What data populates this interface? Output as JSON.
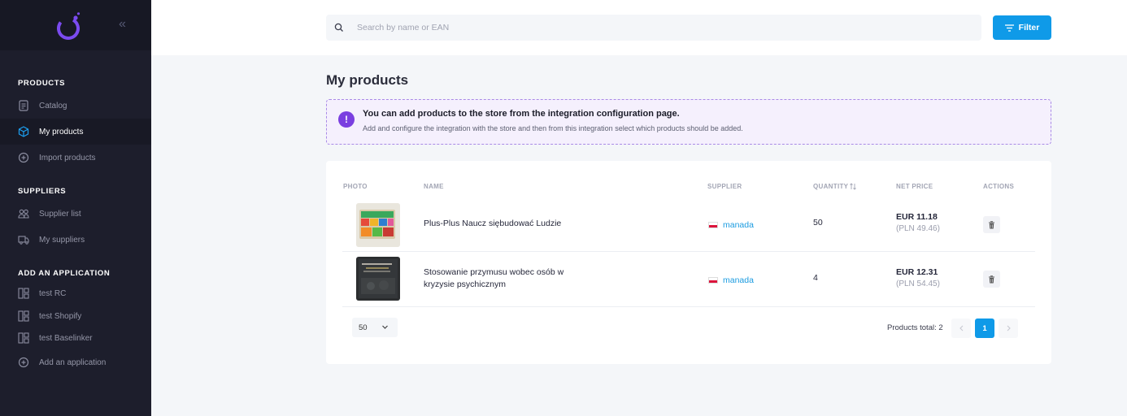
{
  "sidebar": {
    "sections": [
      {
        "title": "PRODUCTS",
        "items": [
          {
            "label": "Catalog",
            "icon": "catalog-icon"
          },
          {
            "label": "My products",
            "icon": "cube-icon",
            "active": true
          },
          {
            "label": "Import products",
            "icon": "plus-circle-icon"
          }
        ]
      },
      {
        "title": "SUPPLIERS",
        "items": [
          {
            "label": "Supplier list",
            "icon": "users-icon"
          },
          {
            "label": "My suppliers",
            "icon": "truck-icon"
          }
        ]
      },
      {
        "title": "ADD AN APPLICATION",
        "items": [
          {
            "label": "test RC",
            "icon": "grid-icon"
          },
          {
            "label": "test Shopify",
            "icon": "grid-icon"
          },
          {
            "label": "test Baselinker",
            "icon": "grid-icon"
          },
          {
            "label": "Add an application",
            "icon": "plus-circle-icon"
          }
        ]
      }
    ]
  },
  "topbar": {
    "search_placeholder": "Search by name or EAN",
    "filter_label": "Filter"
  },
  "main": {
    "title": "My products",
    "alert": {
      "title": "You can add products to the store from the integration configuration page.",
      "text": "Add and configure the integration with the store and then from this integration select which products should be added."
    },
    "table": {
      "columns": {
        "photo": "PHOTO",
        "name": "NAME",
        "supplier": "SUPPLIER",
        "quantity": "QUANTITY",
        "net_price": "NET PRICE",
        "actions": "ACTIONS"
      },
      "rows": [
        {
          "name": "Plus-Plus Naucz siębudować Ludzie",
          "supplier": "manada",
          "quantity": "50",
          "price_eur": "EUR 11.18",
          "price_pln": "(PLN 49.46)"
        },
        {
          "name": "Stosowanie przymusu wobec osób w kryzysie psychicznym",
          "supplier": "manada",
          "quantity": "4",
          "price_eur": "EUR 12.31",
          "price_pln": "(PLN 54.45)"
        }
      ]
    },
    "pagination": {
      "per_page": "50",
      "total": "Products total: 2",
      "current_page": "1"
    }
  },
  "colors": {
    "sidebar_bg": "#1d1e2c",
    "accent": "#0f9ae8",
    "alert_border": "#a98ae6",
    "alert_icon": "#7a3fe0"
  }
}
